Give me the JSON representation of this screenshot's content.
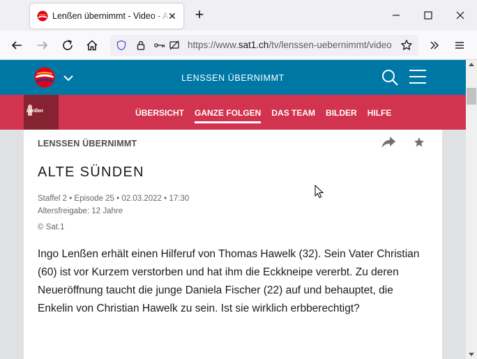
{
  "browser": {
    "tab_title": "Lenßen übernimmt - Video - All",
    "tab_close": "✕",
    "new_tab": "+",
    "url_prefix": "https://www.",
    "url_host": "sat1.ch",
    "url_path": "/tv/lenssen-uebernimmt/video"
  },
  "site": {
    "header_title": "LENSSEN ÜBERNIMMT",
    "show_thumb_label": "Lenßen",
    "nav": [
      {
        "label": "ÜBERSICHT",
        "active": false
      },
      {
        "label": "GANZE FOLGEN",
        "active": true
      },
      {
        "label": "DAS TEAM",
        "active": false
      },
      {
        "label": "BILDER",
        "active": false
      },
      {
        "label": "HILFE",
        "active": false
      }
    ]
  },
  "episode": {
    "show_name": "LENSSEN ÜBERNIMMT",
    "title": "ALTE SÜNDEN",
    "meta_line": "Staffel 2 • Episode 25 • 02.03.2022 • 17:30",
    "age_rating": "Altersfreigabe: 12 Jahre",
    "copyright": "© Sat.1",
    "description": "Ingo Lenßen erhält einen Hilferuf von Thomas Hawelk (32). Sein Vater Christian (60) ist vor Kurzem verstorben und hat ihm die Eckkneipe vererbt. Zu deren Neueröffnung taucht die junge Daniela Fischer (22) auf und behauptet, die Enkelin von Christian Hawelk zu sein. Ist sie wirklich erbberechtigt?"
  },
  "colors": {
    "header_blue": "#0078a6",
    "nav_red": "#d2334f",
    "thumb_dark_red": "#862333"
  }
}
